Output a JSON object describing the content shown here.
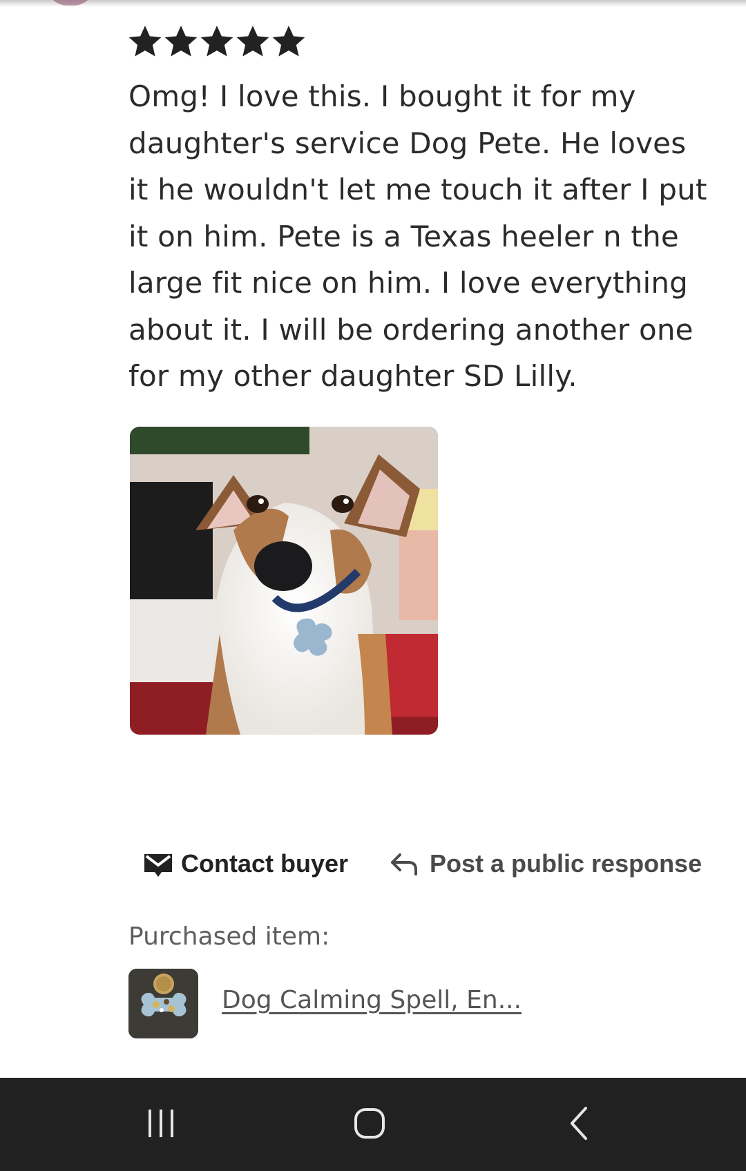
{
  "review": {
    "rating": 5,
    "rating_max": 5,
    "text": "Omg! I love this. I bought it for my daughter's service Dog Pete. He loves it he wouldn't let me touch it after I put it on him. Pete is a Texas heeler n the large fit nice on him. I love everything about it. I will be ordering another one for my other daughter SD Lilly.",
    "star_color": "#222222"
  },
  "actions": {
    "contact_label": "Contact buyer",
    "contact_icon": "envelope-icon",
    "respond_label": "Post a public response",
    "respond_icon": "reply-arrow-icon"
  },
  "purchased": {
    "label": "Purchased item:",
    "item_title": "Dog Calming Spell, En..."
  },
  "navbar": {
    "recents_icon": "recent-apps-icon",
    "home_icon": "home-icon",
    "back_icon": "back-icon"
  }
}
